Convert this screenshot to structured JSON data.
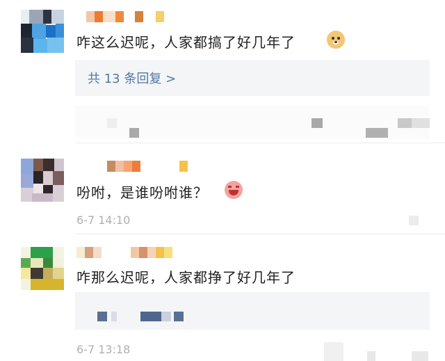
{
  "comments": [
    {
      "text": "咋这么迟呢，人家都搞了好几年了",
      "emoji": "doge-emoji",
      "reply_link": "共 13 条回复 >"
    },
    {
      "text": "吩咐，是谁吩咐谁？",
      "emoji": "laughing-pig-emoji",
      "timestamp": "6-7 14:10"
    },
    {
      "text": "咋那么迟呢，人家都挣了好几年了",
      "timestamp": "6-7 13:18"
    }
  ],
  "colors": {
    "text": "#222222",
    "link": "#5278a6",
    "timestamp": "#b0b0b0",
    "reply_bg": "#f4f5f7"
  }
}
